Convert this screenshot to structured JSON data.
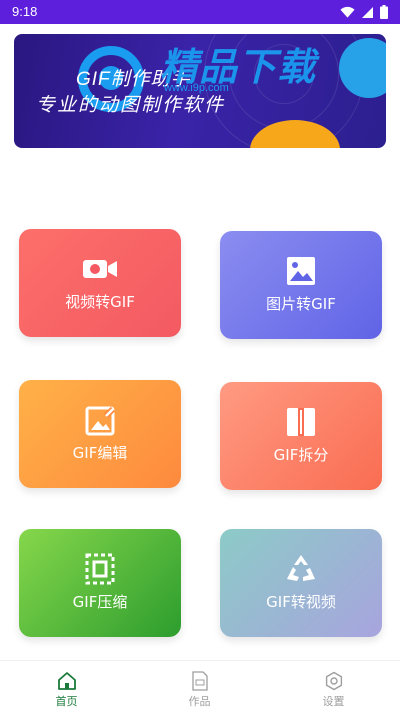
{
  "status_bar": {
    "time": "9:18",
    "background_color": "#5d1fdc",
    "icons": [
      "wifi-icon",
      "signal-icon",
      "battery-icon"
    ]
  },
  "banner": {
    "title": "GIF制作助手",
    "subtitle": "专业的动图制作软件",
    "watermark": "精品下载",
    "watermark_url": "www.i9p.com",
    "background_color": "#2d1b90"
  },
  "tiles": [
    {
      "label": "视频转GIF",
      "icon": "video-camera-icon",
      "color": "#f35a62"
    },
    {
      "label": "图片转GIF",
      "icon": "image-icon",
      "color": "#6064e6"
    },
    {
      "label": "GIF编辑",
      "icon": "image-edit-icon",
      "color": "#fe8a3e"
    },
    {
      "label": "GIF拆分",
      "icon": "split-icon",
      "color": "#f96d52"
    },
    {
      "label": "GIF压缩",
      "icon": "compress-icon",
      "color": "#2d9d2e"
    },
    {
      "label": "GIF转视频",
      "icon": "recycle-arrows-icon",
      "color": "#a8a4de"
    }
  ],
  "bottom_nav": {
    "items": [
      {
        "label": "首页",
        "icon": "home-icon",
        "active": true
      },
      {
        "label": "作品",
        "icon": "gif-file-icon",
        "active": false
      },
      {
        "label": "设置",
        "icon": "settings-icon",
        "active": false
      }
    ],
    "active_color": "#1a7a3a",
    "inactive_color": "#9e9e9e"
  }
}
